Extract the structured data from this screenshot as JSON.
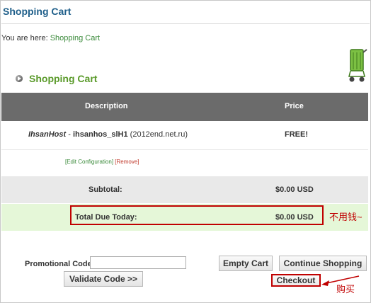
{
  "header": {
    "title": "Shopping Cart",
    "breadcrumb_prefix": "You are here:",
    "breadcrumb_link": "Shopping Cart"
  },
  "section": {
    "title": "Shopping Cart"
  },
  "table": {
    "columns": [
      "Description",
      "Price"
    ],
    "item": {
      "host": "IhsanHost",
      "separator": " - ",
      "plan": "ihsanhos_slH1",
      "domain": " (2012end.net.ru)",
      "price": "FREE!"
    },
    "links": {
      "edit": "[Edit Configuration]",
      "remove": "[Remove]"
    },
    "subtotal": {
      "label": "Subtotal:",
      "value": "$0.00 USD"
    },
    "total": {
      "label": "Total Due Today:",
      "value": "$0.00 USD"
    }
  },
  "promo": {
    "label": "Promotional Code",
    "value": "",
    "validate_label": "Validate Code >>"
  },
  "buttons": {
    "empty_cart": "Empty Cart",
    "continue_shopping": "Continue Shopping",
    "checkout": "Checkout"
  },
  "annotations": {
    "total_note": "不用钱~",
    "checkout_note": "购买"
  },
  "colors": {
    "title_blue": "#1f5f8a",
    "section_green": "#5a9a2a",
    "header_gray": "#6b6b6b",
    "total_green_bg": "#e5f7d8",
    "annotation_red": "#c00000"
  }
}
